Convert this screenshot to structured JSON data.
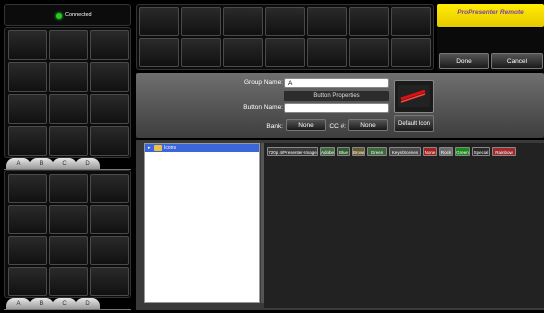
{
  "status": {
    "text": "Connected",
    "color": "#22cc22"
  },
  "bank_tabs_top": [
    "A",
    "B",
    "C",
    "D"
  ],
  "bank_tabs_bottom": [
    "A",
    "B",
    "C",
    "D"
  ],
  "logo": {
    "text": "ProPresenter Remote",
    "color": "#f2e600"
  },
  "actions": {
    "done": "Done",
    "cancel": "Cancel"
  },
  "properties": {
    "group_name_label": "Group Name:",
    "group_name_value": "A",
    "header": "Button Properties",
    "button_name_label": "Button Name:",
    "button_name_value": "",
    "bank_label": "Bank:",
    "bank_value": "None",
    "cc_label": "CC #:",
    "cc_value": "None",
    "default_icon": "Default Icon"
  },
  "tree": {
    "root": "Icons"
  },
  "icon_chips": [
    {
      "label": "720p 4/Presenter-Image",
      "bg": "#3a3a3a"
    },
    {
      "label": "Adobe",
      "bg": "#3f6b3f"
    },
    {
      "label": "Blue",
      "bg": "#2f5a2f"
    },
    {
      "label": "Brown",
      "bg": "#6b5a2e"
    },
    {
      "label": "Green",
      "bg": "#3d6a3d"
    },
    {
      "label": "Keys/Scenes",
      "bg": "#4a4a4a"
    },
    {
      "label": "None",
      "bg": "#a52222"
    },
    {
      "label": "Rock",
      "bg": "#6a6a6a"
    },
    {
      "label": "Green",
      "bg": "#1a8a1a"
    },
    {
      "label": "Special",
      "bg": "#2a2a2a"
    },
    {
      "label": "Rainbow",
      "bg": "#a02a2a"
    }
  ]
}
